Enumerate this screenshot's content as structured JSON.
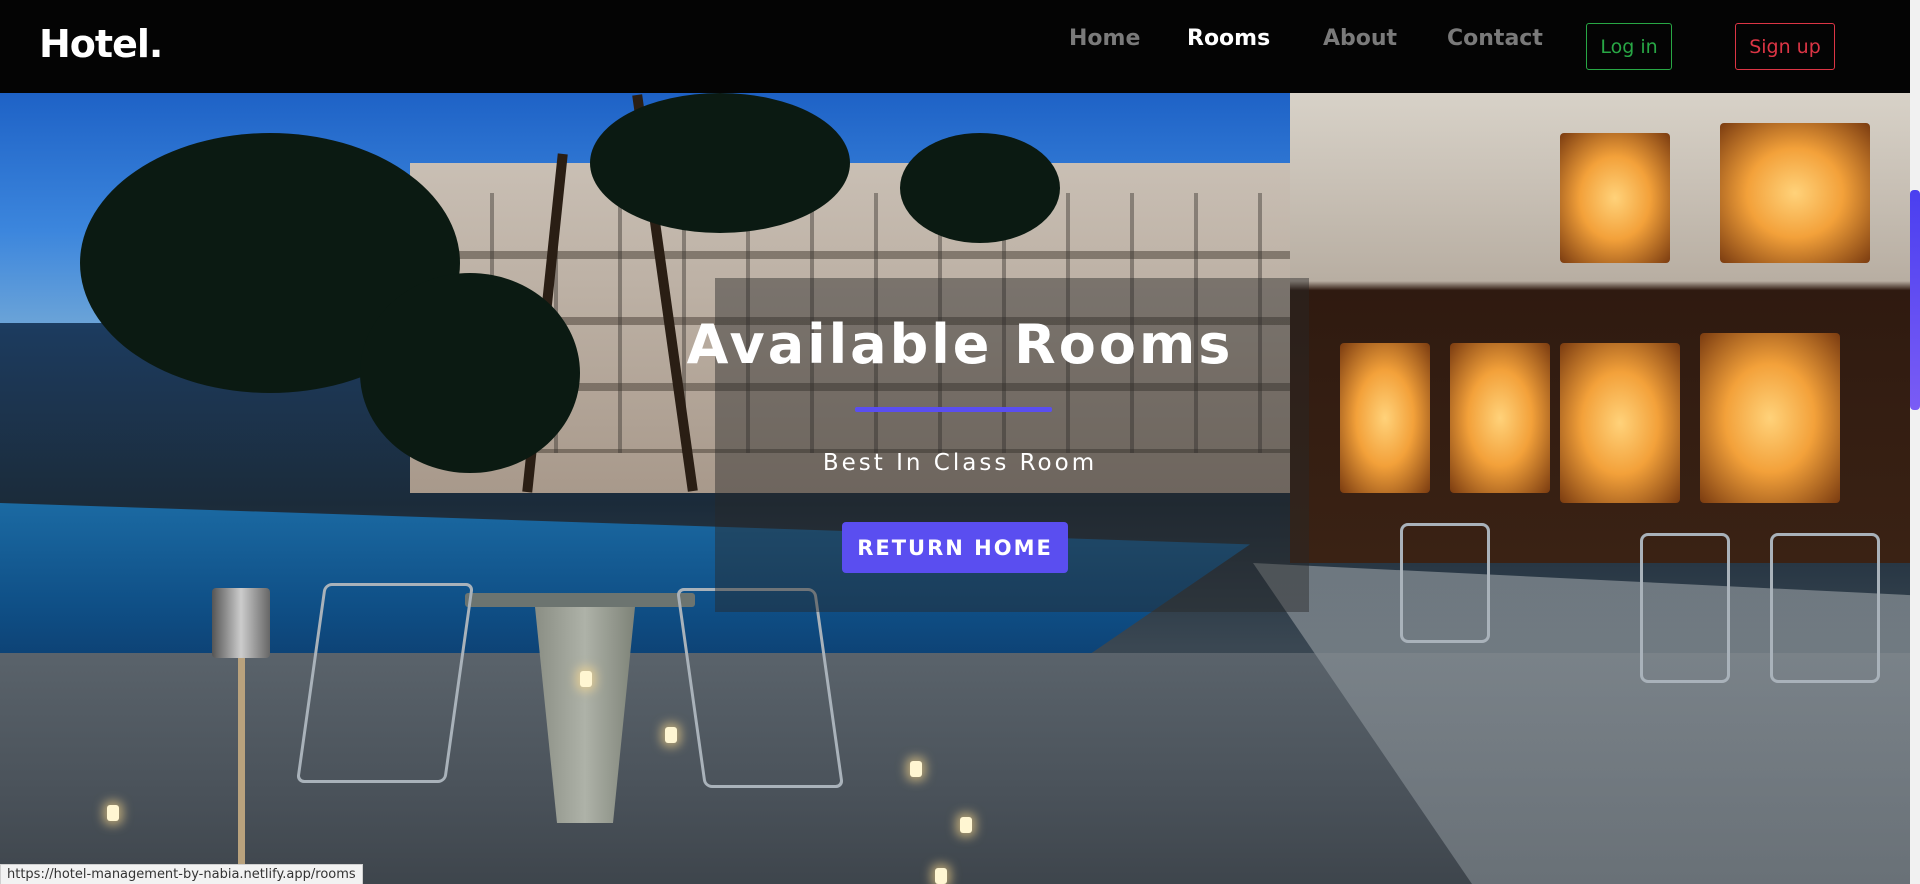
{
  "navbar": {
    "brand": "Hotel.",
    "links": [
      {
        "label": "Home"
      },
      {
        "label": "Rooms"
      },
      {
        "label": "About"
      },
      {
        "label": "Contact"
      }
    ],
    "login_label": "Log in",
    "signup_label": "Sign up"
  },
  "hero": {
    "title": "Available Rooms",
    "subtitle": "Best In Class Room",
    "button_label": "RETURN HOME"
  },
  "status_bar": {
    "url": "https://hotel-management-by-nabia.netlify.app/rooms"
  },
  "colors": {
    "accent": "#5a4ef0",
    "login": "#28a745",
    "signup": "#dc3545",
    "navbar_bg": "#040404"
  }
}
